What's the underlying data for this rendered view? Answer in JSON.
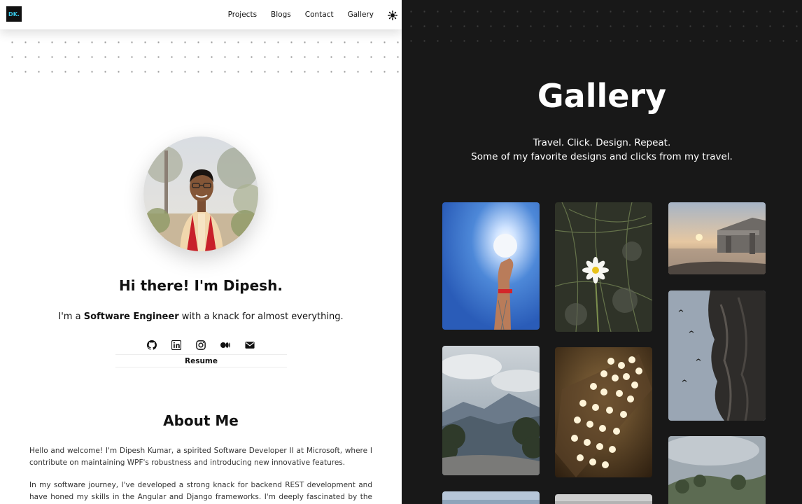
{
  "nav": {
    "logo": "DK.",
    "links": [
      "Projects",
      "Blogs",
      "Contact",
      "Gallery"
    ]
  },
  "hero": {
    "greeting": "Hi there! I'm Dipesh.",
    "tagline_pre": "I'm a ",
    "tagline_bold": "Software Engineer",
    "tagline_post": " with a knack for almost everything.",
    "resume_label": "Resume",
    "social_icons": [
      "github-icon",
      "linkedin-icon",
      "instagram-icon",
      "medium-icon",
      "mail-icon"
    ]
  },
  "about": {
    "title": "About Me",
    "p1": "Hello and welcome! I'm Dipesh Kumar, a spirited Software Developer II at Microsoft, where I contribute on maintaining WPF's robustness and introducing new innovative features.",
    "p2": "In my software journey, I've developed a strong knack for backend REST development and have honed my skills in the Angular and Django frameworks. I'm deeply fascinated by the realms of data"
  },
  "gallery": {
    "title": "Gallery",
    "subtitle_line1": "Travel. Click. Design. Repeat.",
    "subtitle_line2": "Some of my favorite designs and clicks from my travel.",
    "photos": [
      "hand holding glass ball against blue sky",
      "daisy flower",
      "sunset at lake ruins",
      "mountain valley landscape",
      "candles on a tray",
      "rock cliff with birds",
      "partial photo",
      "partial photo",
      "cloudy hillside"
    ]
  },
  "colors": {
    "left_bg": "#ffffff",
    "right_bg": "#181818",
    "logo_bg": "#111111",
    "logo_text": "#38c8e8"
  }
}
